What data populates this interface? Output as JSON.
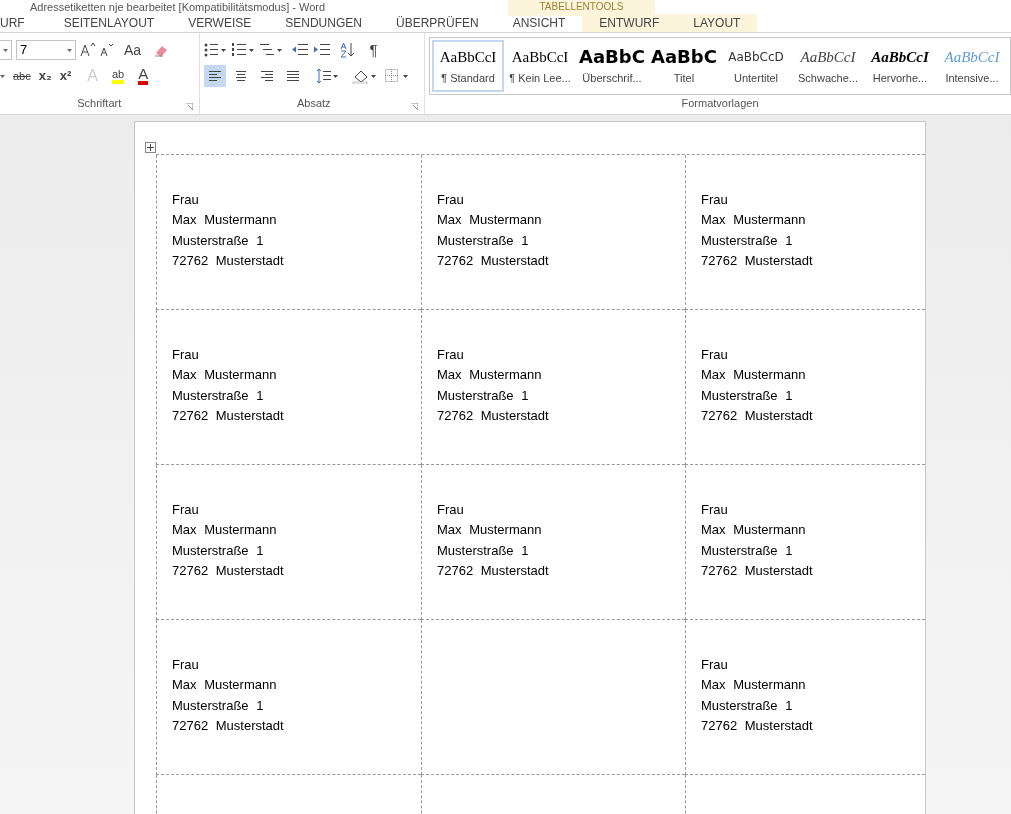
{
  "window": {
    "title": "Adressetiketten nje bearbeitet [Kompatibilitätsmodus] - Word",
    "context_label": "TABELLENTOOLS"
  },
  "tabs": [
    {
      "label": "URF",
      "selected": false,
      "contextual": false
    },
    {
      "label": "SEITENLAYOUT",
      "selected": false,
      "contextual": false
    },
    {
      "label": "VERWEISE",
      "selected": false,
      "contextual": false
    },
    {
      "label": "SENDUNGEN",
      "selected": false,
      "contextual": false
    },
    {
      "label": "ÜBERPRÜFEN",
      "selected": false,
      "contextual": false
    },
    {
      "label": "ANSICHT",
      "selected": false,
      "contextual": false
    },
    {
      "label": "ENTWURF",
      "selected": false,
      "contextual": true
    },
    {
      "label": "LAYOUT",
      "selected": false,
      "contextual": true
    }
  ],
  "font_group": {
    "label": "Schriftart",
    "font_size": "7",
    "change_case": "Aa",
    "strike": "abc",
    "sub": "x₂",
    "sup": "x²",
    "effects": "A",
    "highlight": "ab",
    "font_color": "A"
  },
  "paragraph_group": {
    "label": "Absatz",
    "pilcrow": "¶",
    "alignments": [
      {
        "kind": "left",
        "selected": true
      },
      {
        "kind": "center",
        "selected": false
      },
      {
        "kind": "right",
        "selected": false
      },
      {
        "kind": "justify",
        "selected": false
      }
    ]
  },
  "styles_group": {
    "label": "Formatvorlagen",
    "styles": [
      {
        "preview": "AaBbCcI",
        "label": "¶ Standard",
        "kind": "serif",
        "selected": true
      },
      {
        "preview": "AaBbCcI",
        "label": "¶ Kein Lee...",
        "kind": "serif",
        "selected": false
      },
      {
        "preview": "AaBbC",
        "label": "Überschrif...",
        "kind": "heading",
        "selected": false
      },
      {
        "preview": "AaBbC",
        "label": "Titel",
        "kind": "title",
        "selected": false
      },
      {
        "preview": "AaBbCcD",
        "label": "Untertitel",
        "kind": "subtitle",
        "selected": false
      },
      {
        "preview": "AaBbCcI",
        "label": "Schwache...",
        "kind": "italic",
        "selected": false
      },
      {
        "preview": "AaBbCcI",
        "label": "Hervorhe...",
        "kind": "bolditalic",
        "selected": false
      },
      {
        "preview": "AaBbCcI",
        "label": "Intensive...",
        "kind": "blue",
        "selected": false
      }
    ]
  },
  "table": {
    "rows": [
      [
        [
          "Frau",
          "Max Mustermann",
          "Musterstraße 1",
          "72762 Musterstadt"
        ],
        [
          "Frau",
          "Max Mustermann",
          "Musterstraße 1",
          "72762 Musterstadt"
        ],
        [
          "Frau",
          "Max Mustermann",
          "Musterstraße 1",
          "72762 Musterstadt"
        ]
      ],
      [
        [
          "Frau",
          "Max Mustermann",
          "Musterstraße 1",
          "72762 Musterstadt"
        ],
        [
          "Frau",
          "Max Mustermann",
          "Musterstraße 1",
          "72762 Musterstadt"
        ],
        [
          "Frau",
          "Max Mustermann",
          "Musterstraße 1",
          "72762 Musterstadt"
        ]
      ],
      [
        [
          "Frau",
          "Max Mustermann",
          "Musterstraße 1",
          "72762 Musterstadt"
        ],
        [
          "Frau",
          "Max Mustermann",
          "Musterstraße 1",
          "72762 Musterstadt"
        ],
        [
          "Frau",
          "Max Mustermann",
          "Musterstraße 1",
          "72762 Musterstadt"
        ]
      ],
      [
        [
          "Frau",
          "Max Mustermann",
          "Musterstraße 1",
          "72762 Musterstadt"
        ],
        [],
        [
          "Frau",
          "Max Mustermann",
          "Musterstraße 1",
          "72762 Musterstadt"
        ]
      ],
      [
        [],
        [],
        []
      ]
    ]
  }
}
